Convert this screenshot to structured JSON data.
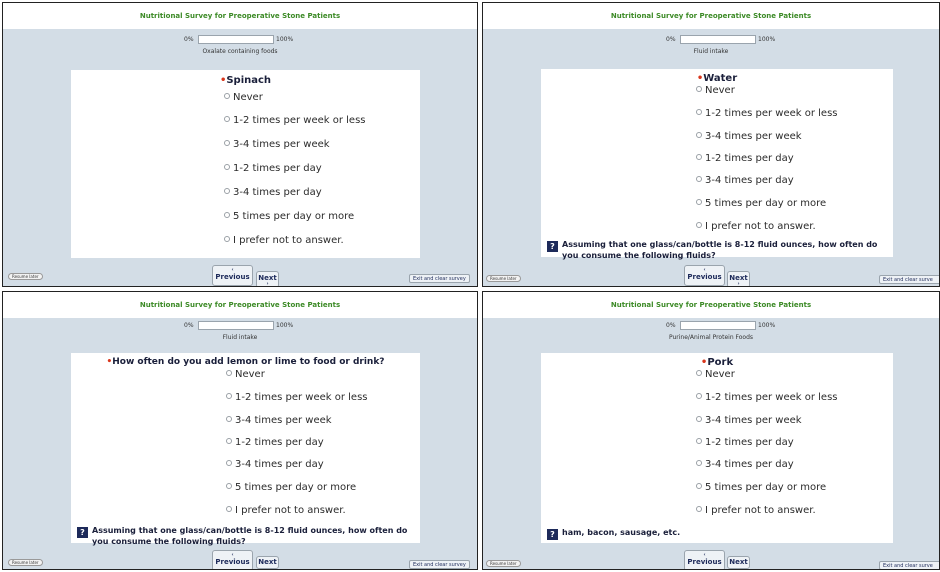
{
  "survey_title": "Nutritional Survey for Preoperative Stone Patients",
  "progress_start": "0%",
  "progress_end": "100%",
  "progress_value": 0,
  "options": [
    "Never",
    "1-2 times per week or less",
    "3-4 times per week",
    "1-2 times per day",
    "3-4 times per day",
    "5 times per day or more",
    "I prefer not to answer."
  ],
  "nav": {
    "previous_label": "Previous",
    "next_label": "Next",
    "resume_label": "Resume later",
    "exit_label": "Exit and clear survey",
    "exit_label_cut": "Exit and clear surve",
    "arrow_up": "‹",
    "arrow_down": "›"
  },
  "help_icon": "?",
  "required_marker": "•",
  "panels": [
    {
      "section": "Oxalate containing foods",
      "question": "Spinach",
      "note": ""
    },
    {
      "section": "Fluid intake",
      "question": "Water",
      "note_line1": "Assuming that one glass/can/bottle is 8-12 fluid ounces, how often do",
      "note_line2": "you consume the following fluids?"
    },
    {
      "section": "Fluid intake",
      "question": "How often do you add lemon or lime to food or drink?",
      "note_line1": "Assuming that one glass/can/bottle is 8-12 fluid ounces, how often do",
      "note_line2": "you consume the following fluids?"
    },
    {
      "section": "Purine/Animal Protein Foods",
      "question": "Pork",
      "note_line1": "ham, bacon, sausage, etc."
    }
  ]
}
